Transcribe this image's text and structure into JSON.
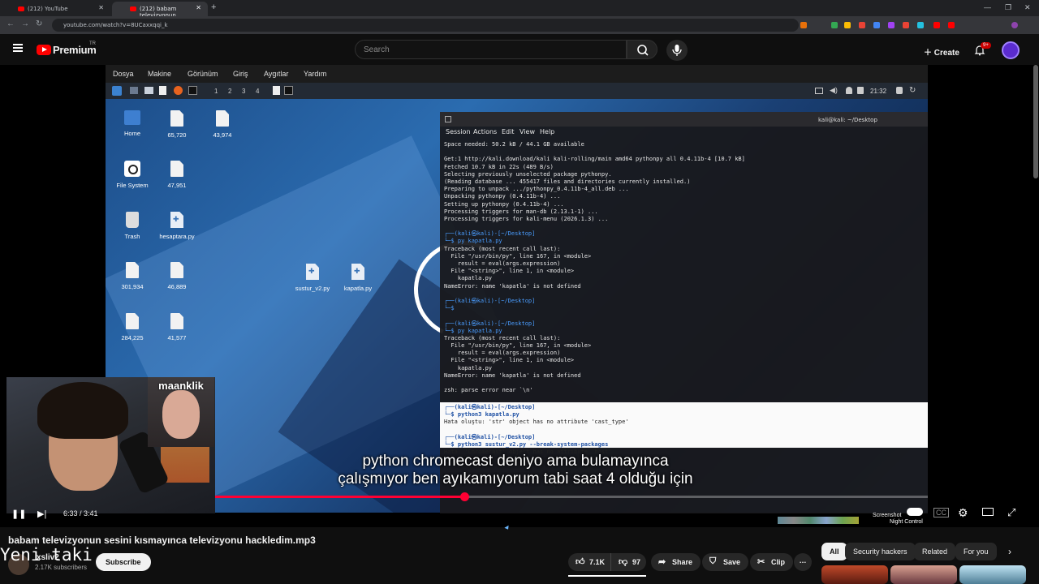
{
  "browser": {
    "tabs": [
      {
        "title": "(212) YouTube",
        "close": "✕"
      },
      {
        "title": "(212) babam televizyonun",
        "close": "✕"
      }
    ],
    "new_tab": "+",
    "url": "youtube.com/watch?v=8UCaxxqqi_k",
    "window_controls": [
      "—",
      "❐",
      "✕"
    ]
  },
  "youtube": {
    "brand": "Premium",
    "brand_region": "TR",
    "search_placeholder": "Search",
    "create_label": "Create",
    "notification_count": "9+"
  },
  "vm": {
    "menu": [
      "Dosya",
      "Makine",
      "Görünüm",
      "Giriş",
      "Aygıtlar",
      "Yardım"
    ],
    "workspaces": [
      "1",
      "2",
      "3",
      "4"
    ],
    "clock": "21:32",
    "desktop_icons": [
      {
        "label": "Home"
      },
      {
        "label": "65,720"
      },
      {
        "label": "43,974"
      },
      {
        "label": "File System"
      },
      {
        "label": "47,951"
      },
      {
        "label": "Trash"
      },
      {
        "label": "hesaptara.py"
      },
      {
        "label": "301,934"
      },
      {
        "label": "46,889"
      },
      {
        "label": "284,225"
      },
      {
        "label": "41,577"
      },
      {
        "label": "sustur_v2.py"
      },
      {
        "label": "kapatla.py"
      }
    ],
    "terminal": {
      "title": "kali@kali: ~/Desktop",
      "menu": [
        "Session",
        "Actions",
        "Edit",
        "View",
        "Help"
      ],
      "lines": [
        "Space needed: 50.2 kB / 44.1 GB available",
        "",
        "Get:1 http://kali.download/kali kali-rolling/main amd64 pythonpy all 0.4.11b-4 [10.7 kB]",
        "Fetched 10.7 kB in 22s (489 B/s)",
        "Selecting previously unselected package pythonpy.",
        "(Reading database ... 455417 files and directories currently installed.)",
        "Preparing to unpack .../pythonpy_0.4.11b-4_all.deb ...",
        "Unpacking pythonpy (0.4.11b-4) ...",
        "Setting up pythonpy (0.4.11b-4) ...",
        "Processing triggers for man-db (2.13.1-1) ...",
        "Processing triggers for kali-menu (2026.1.3) ...",
        "",
        "┌──(kali㉿kali)-[~/Desktop]",
        "└─$ py kapatla.py",
        "Traceback (most recent call last):",
        "  File \"/usr/bin/py\", line 167, in <module>",
        "    result = eval(args.expression)",
        "  File \"<string>\", line 1, in <module>",
        "    kapatla.py",
        "NameError: name 'kapatla' is not defined",
        "",
        "┌──(kali㉿kali)-[~/Desktop]",
        "└─$",
        "",
        "┌──(kali㉿kali)-[~/Desktop]",
        "└─$ py kapatla.py",
        "Traceback (most recent call last):",
        "  File \"/usr/bin/py\", line 167, in <module>",
        "    result = eval(args.expression)",
        "  File \"<string>\", line 1, in <module>",
        "    kapatla.py",
        "NameError: name 'kapatla' is not defined",
        "",
        "zsh: parse error near `\\n'"
      ],
      "light_lines": [
        "┌──(kali㉿kali)-[~/Desktop]",
        "└─$ python3 kapatla.py",
        "Hata oluştu: 'str' object has no attribute 'cast_type'",
        "",
        "┌──(kali㉿kali)-[~/Desktop]",
        "└─$ python3 sustur_v2.py --break-system-packages",
        "Hata: 'Chromecast' object has no attribute 'host'"
      ]
    }
  },
  "webcam": {
    "guest_name": "maanklik"
  },
  "subtitles": [
    "python chromecast deniyo ama bulamayınca",
    "çalışmıyor ben ayıkamıyorum tabi saat 4 olduğu için"
  ],
  "player": {
    "progress": 0.35,
    "time": "6:33 / 3:41",
    "tray_label": "Screenshot",
    "tray_label2": "Night Control"
  },
  "video": {
    "title": "babam televizyonun sesini kısmayınca televizyonu hackledim.mp3",
    "overlay_text": "Yeni taki",
    "channel_name": "xsliv2",
    "subscribers": "2.17K subscribers",
    "subscribe_label": "Subscribe",
    "likes": "7.1K",
    "dislikes": "97",
    "share_label": "Share",
    "save_label": "Save",
    "clip_label": "Clip",
    "more_label": "…"
  },
  "chips": [
    "All",
    "Security hackers",
    "Related",
    "For you"
  ]
}
